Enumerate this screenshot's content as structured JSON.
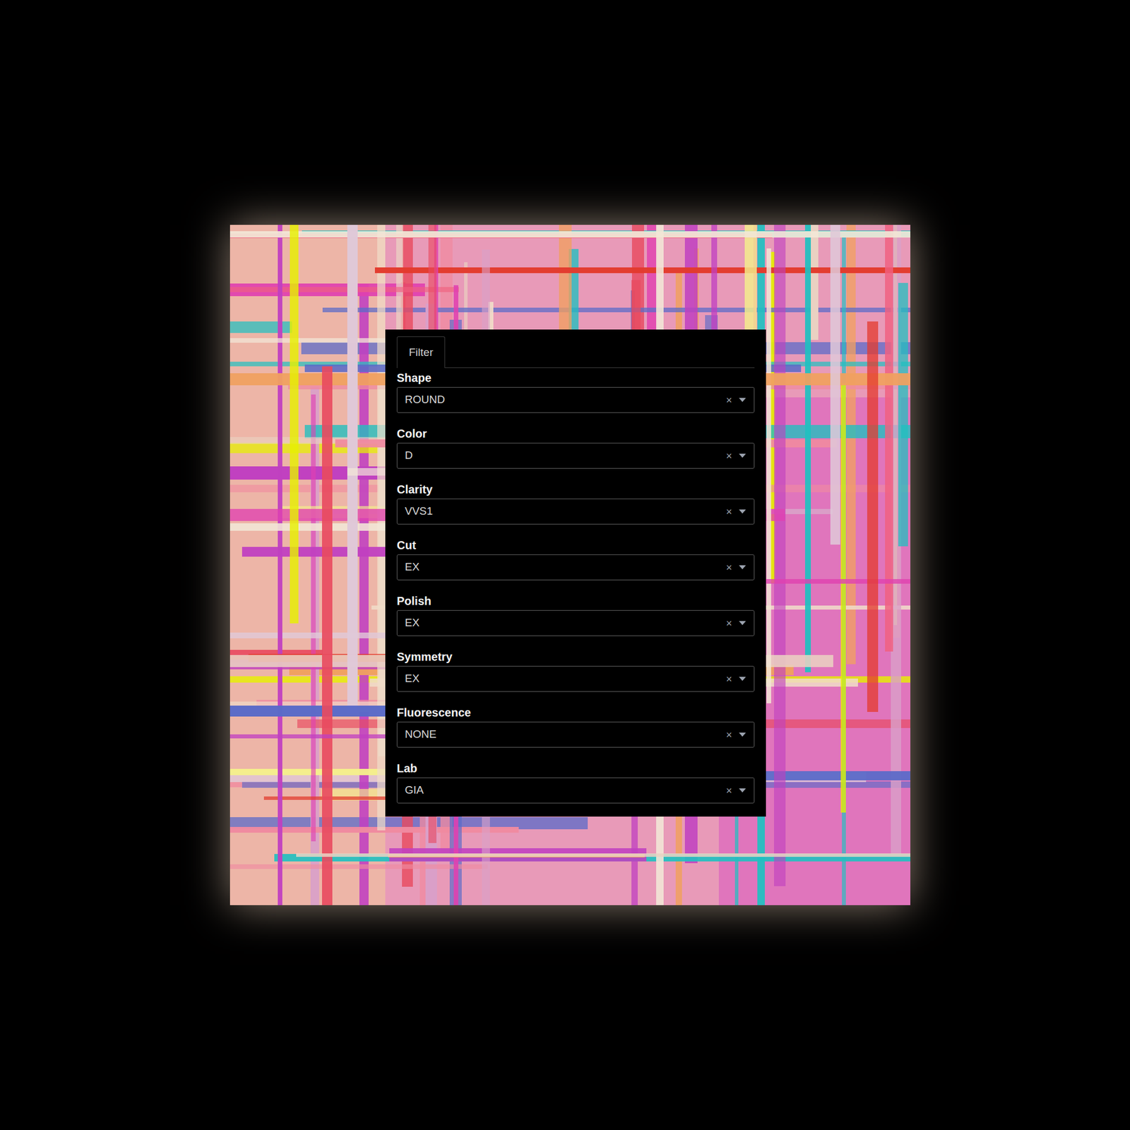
{
  "tabs": [
    {
      "label": "Filter",
      "selected": true
    }
  ],
  "fields": [
    {
      "label": "Shape",
      "value": "ROUND",
      "clear": "×"
    },
    {
      "label": "Color",
      "value": "D",
      "clear": "×"
    },
    {
      "label": "Clarity",
      "value": "VVS1",
      "clear": "×"
    },
    {
      "label": "Cut",
      "value": "EX",
      "clear": "×"
    },
    {
      "label": "Polish",
      "value": "EX",
      "clear": "×"
    },
    {
      "label": "Symmetry",
      "value": "EX",
      "clear": "×"
    },
    {
      "label": "Fluorescence",
      "value": "NONE",
      "clear": "×"
    },
    {
      "label": "Lab",
      "value": "GIA",
      "clear": "×"
    }
  ]
}
